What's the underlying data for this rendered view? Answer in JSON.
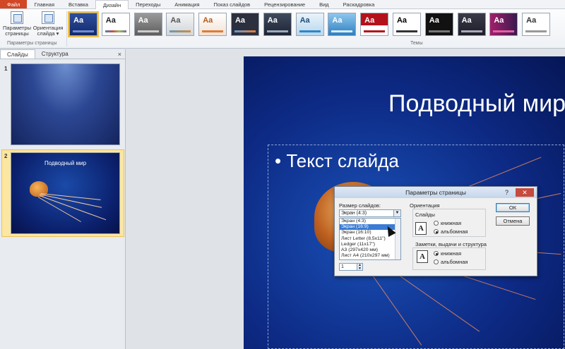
{
  "tabs": [
    "Файл",
    "Главная",
    "Вставка",
    "Дизайн",
    "Переходы",
    "Анимация",
    "Показ слайдов",
    "Рецензирование",
    "Вид",
    "Раскадровка"
  ],
  "ribbon": {
    "page_setup_line1": "Параметры",
    "page_setup_line2": "страницы",
    "orientation_line1": "Ориентация",
    "orientation_line2": "слайда ▾",
    "group_page_setup": "Параметры страницы",
    "group_themes": "Темы",
    "theme_label": "Aa"
  },
  "panel": {
    "tab_slides": "Слайды",
    "tab_outline": "Структура",
    "close": "×",
    "slide1_num": "1",
    "slide2_num": "2",
    "slide2_title": "Подводный мир"
  },
  "slide": {
    "title": "Подводный мир",
    "bullet": "•  Текст слайда"
  },
  "dialog": {
    "title": "Параметры страницы",
    "help": "?",
    "close": "✕",
    "size_label": "Размер слайдов:",
    "size_value": "Экран (4:3)",
    "size_options": [
      "Экран (4:3)",
      "Экран (16:9)",
      "Экран (16:10)",
      "Лист Letter (8,5x11\")",
      "Ledger (11x17\")",
      "A3 (297x420 мм)",
      "Лист A4 (210x297 мм)"
    ],
    "start_number": "1",
    "orientation_label": "Ориентация",
    "slides_label": "Слайды",
    "notes_label": "Заметки, выдачи и структура",
    "portrait": "книжная",
    "landscape": "альбомная",
    "ok": "ОК",
    "cancel": "Отмена"
  },
  "colors": {
    "file_tab": "#d24726",
    "selection": "#3a7bd5",
    "dialog_close": "#c74a3c"
  }
}
